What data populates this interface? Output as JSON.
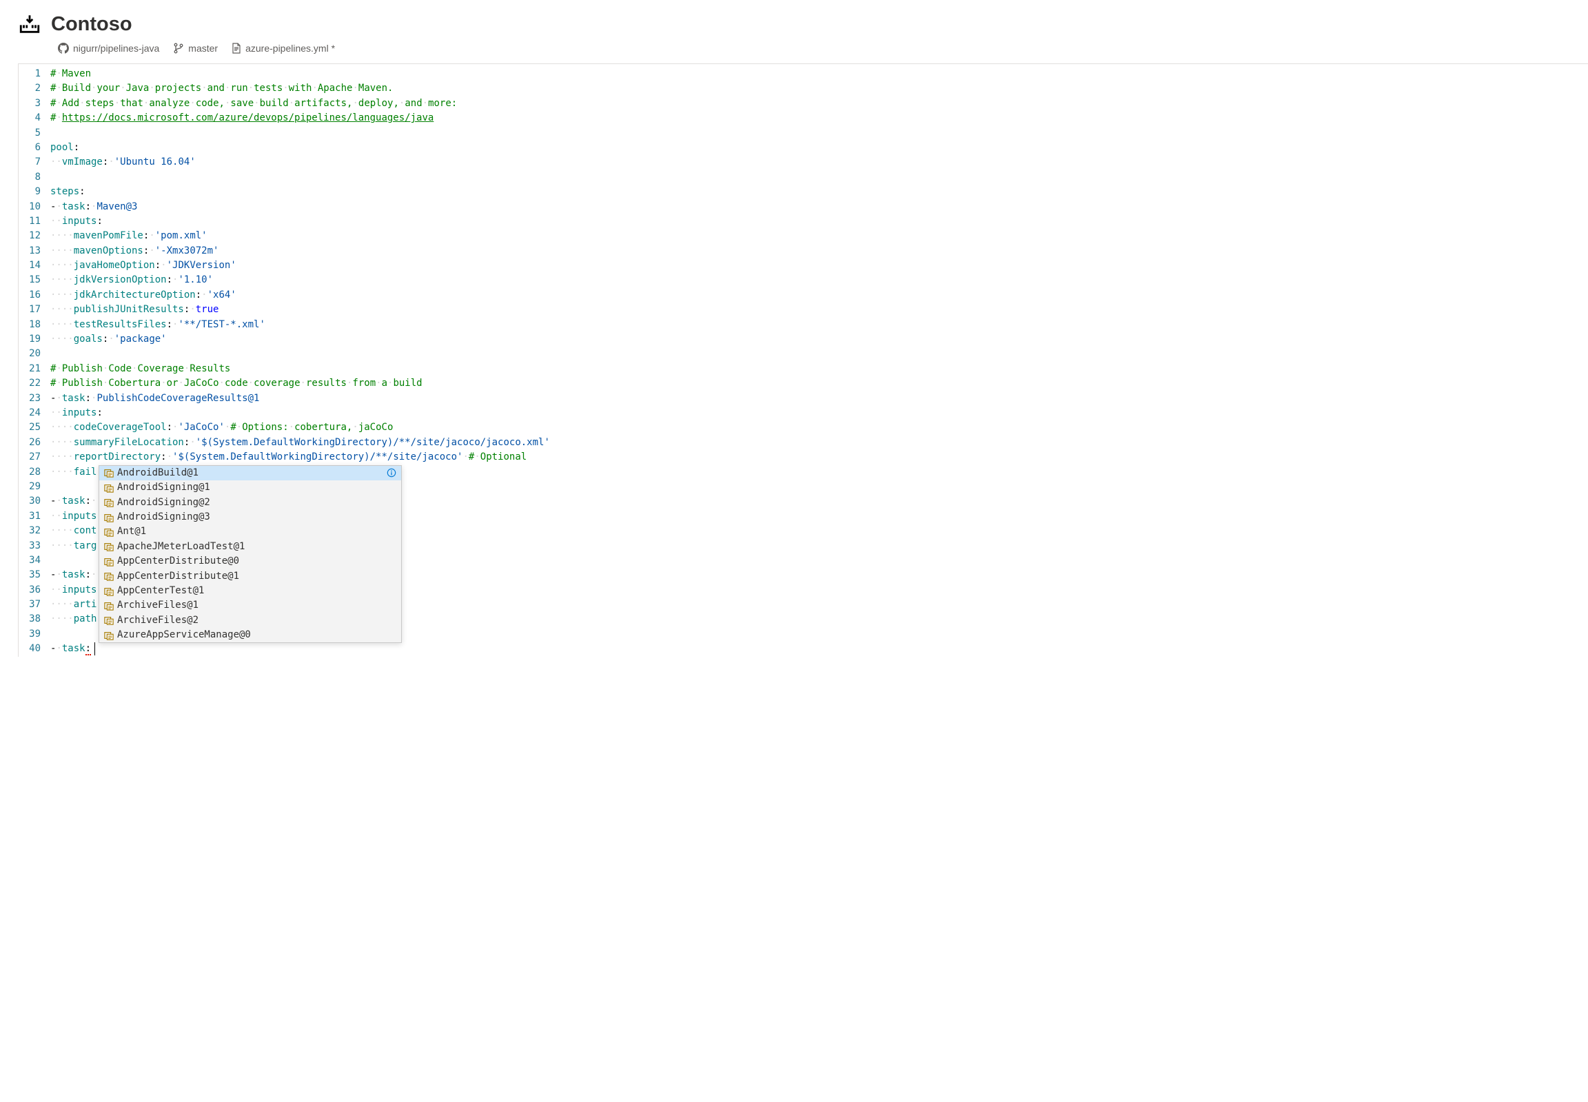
{
  "header": {
    "title": "Contoso"
  },
  "breadcrumb": {
    "repo": "nigurr/pipelines-java",
    "branch": "master",
    "file": "azure-pipelines.yml *"
  },
  "code": {
    "lines": [
      [
        {
          "t": "comment",
          "v": "#"
        },
        {
          "t": "ws",
          "v": "·"
        },
        {
          "t": "comment",
          "v": "Maven"
        }
      ],
      [
        {
          "t": "comment",
          "v": "#"
        },
        {
          "t": "ws",
          "v": "·"
        },
        {
          "t": "comment",
          "v": "Build"
        },
        {
          "t": "ws",
          "v": "·"
        },
        {
          "t": "comment",
          "v": "your"
        },
        {
          "t": "ws",
          "v": "·"
        },
        {
          "t": "comment",
          "v": "Java"
        },
        {
          "t": "ws",
          "v": "·"
        },
        {
          "t": "comment",
          "v": "projects"
        },
        {
          "t": "ws",
          "v": "·"
        },
        {
          "t": "comment",
          "v": "and"
        },
        {
          "t": "ws",
          "v": "·"
        },
        {
          "t": "comment",
          "v": "run"
        },
        {
          "t": "ws",
          "v": "·"
        },
        {
          "t": "comment",
          "v": "tests"
        },
        {
          "t": "ws",
          "v": "·"
        },
        {
          "t": "comment",
          "v": "with"
        },
        {
          "t": "ws",
          "v": "·"
        },
        {
          "t": "comment",
          "v": "Apache"
        },
        {
          "t": "ws",
          "v": "·"
        },
        {
          "t": "comment",
          "v": "Maven."
        }
      ],
      [
        {
          "t": "comment",
          "v": "#"
        },
        {
          "t": "ws",
          "v": "·"
        },
        {
          "t": "comment",
          "v": "Add"
        },
        {
          "t": "ws",
          "v": "·"
        },
        {
          "t": "comment",
          "v": "steps"
        },
        {
          "t": "ws",
          "v": "·"
        },
        {
          "t": "comment",
          "v": "that"
        },
        {
          "t": "ws",
          "v": "·"
        },
        {
          "t": "comment",
          "v": "analyze"
        },
        {
          "t": "ws",
          "v": "·"
        },
        {
          "t": "comment",
          "v": "code,"
        },
        {
          "t": "ws",
          "v": "·"
        },
        {
          "t": "comment",
          "v": "save"
        },
        {
          "t": "ws",
          "v": "·"
        },
        {
          "t": "comment",
          "v": "build"
        },
        {
          "t": "ws",
          "v": "·"
        },
        {
          "t": "comment",
          "v": "artifacts,"
        },
        {
          "t": "ws",
          "v": "·"
        },
        {
          "t": "comment",
          "v": "deploy,"
        },
        {
          "t": "ws",
          "v": "·"
        },
        {
          "t": "comment",
          "v": "and"
        },
        {
          "t": "ws",
          "v": "·"
        },
        {
          "t": "comment",
          "v": "more:"
        }
      ],
      [
        {
          "t": "comment",
          "v": "#"
        },
        {
          "t": "ws",
          "v": "·"
        },
        {
          "t": "comment-link",
          "v": "https://docs.microsoft.com/azure/devops/pipelines/languages/java"
        }
      ],
      [],
      [
        {
          "t": "key",
          "v": "pool"
        },
        {
          "t": "plain",
          "v": ":"
        }
      ],
      [
        {
          "t": "ws",
          "v": "··"
        },
        {
          "t": "key",
          "v": "vmImage"
        },
        {
          "t": "plain",
          "v": ":"
        },
        {
          "t": "ws",
          "v": "·"
        },
        {
          "t": "string",
          "v": "'Ubuntu 16.04'"
        }
      ],
      [],
      [
        {
          "t": "key",
          "v": "steps"
        },
        {
          "t": "plain",
          "v": ":"
        }
      ],
      [
        {
          "t": "plain",
          "v": "-"
        },
        {
          "t": "ws",
          "v": "·"
        },
        {
          "t": "key",
          "v": "task"
        },
        {
          "t": "plain",
          "v": ":"
        },
        {
          "t": "ws",
          "v": "·"
        },
        {
          "t": "string",
          "v": "Maven@3"
        }
      ],
      [
        {
          "t": "ws",
          "v": "··"
        },
        {
          "t": "key",
          "v": "inputs"
        },
        {
          "t": "plain",
          "v": ":"
        }
      ],
      [
        {
          "t": "ws",
          "v": "····"
        },
        {
          "t": "key",
          "v": "mavenPomFile"
        },
        {
          "t": "plain",
          "v": ":"
        },
        {
          "t": "ws",
          "v": "·"
        },
        {
          "t": "string",
          "v": "'pom.xml'"
        }
      ],
      [
        {
          "t": "ws",
          "v": "····"
        },
        {
          "t": "key",
          "v": "mavenOptions"
        },
        {
          "t": "plain",
          "v": ":"
        },
        {
          "t": "ws",
          "v": "·"
        },
        {
          "t": "string",
          "v": "'-Xmx3072m'"
        }
      ],
      [
        {
          "t": "ws",
          "v": "····"
        },
        {
          "t": "key",
          "v": "javaHomeOption"
        },
        {
          "t": "plain",
          "v": ":"
        },
        {
          "t": "ws",
          "v": "·"
        },
        {
          "t": "string",
          "v": "'JDKVersion'"
        }
      ],
      [
        {
          "t": "ws",
          "v": "····"
        },
        {
          "t": "key",
          "v": "jdkVersionOption"
        },
        {
          "t": "plain",
          "v": ":"
        },
        {
          "t": "ws",
          "v": "·"
        },
        {
          "t": "string",
          "v": "'1.10'"
        }
      ],
      [
        {
          "t": "ws",
          "v": "····"
        },
        {
          "t": "key",
          "v": "jdkArchitectureOption"
        },
        {
          "t": "plain",
          "v": ":"
        },
        {
          "t": "ws",
          "v": "·"
        },
        {
          "t": "string",
          "v": "'x64'"
        }
      ],
      [
        {
          "t": "ws",
          "v": "····"
        },
        {
          "t": "key",
          "v": "publishJUnitResults"
        },
        {
          "t": "plain",
          "v": ":"
        },
        {
          "t": "ws",
          "v": "·"
        },
        {
          "t": "bool",
          "v": "true"
        }
      ],
      [
        {
          "t": "ws",
          "v": "····"
        },
        {
          "t": "key",
          "v": "testResultsFiles"
        },
        {
          "t": "plain",
          "v": ":"
        },
        {
          "t": "ws",
          "v": "·"
        },
        {
          "t": "string",
          "v": "'**/TEST-*.xml'"
        }
      ],
      [
        {
          "t": "ws",
          "v": "····"
        },
        {
          "t": "key",
          "v": "goals"
        },
        {
          "t": "plain",
          "v": ":"
        },
        {
          "t": "ws",
          "v": "·"
        },
        {
          "t": "string",
          "v": "'package'"
        }
      ],
      [],
      [
        {
          "t": "comment",
          "v": "#"
        },
        {
          "t": "ws",
          "v": "·"
        },
        {
          "t": "comment",
          "v": "Publish"
        },
        {
          "t": "ws",
          "v": "·"
        },
        {
          "t": "comment",
          "v": "Code"
        },
        {
          "t": "ws",
          "v": "·"
        },
        {
          "t": "comment",
          "v": "Coverage"
        },
        {
          "t": "ws",
          "v": "·"
        },
        {
          "t": "comment",
          "v": "Results"
        }
      ],
      [
        {
          "t": "comment",
          "v": "#"
        },
        {
          "t": "ws",
          "v": "·"
        },
        {
          "t": "comment",
          "v": "Publish"
        },
        {
          "t": "ws",
          "v": "·"
        },
        {
          "t": "comment",
          "v": "Cobertura"
        },
        {
          "t": "ws",
          "v": "·"
        },
        {
          "t": "comment",
          "v": "or"
        },
        {
          "t": "ws",
          "v": "·"
        },
        {
          "t": "comment",
          "v": "JaCoCo"
        },
        {
          "t": "ws",
          "v": "·"
        },
        {
          "t": "comment",
          "v": "code"
        },
        {
          "t": "ws",
          "v": "·"
        },
        {
          "t": "comment",
          "v": "coverage"
        },
        {
          "t": "ws",
          "v": "·"
        },
        {
          "t": "comment",
          "v": "results"
        },
        {
          "t": "ws",
          "v": "·"
        },
        {
          "t": "comment",
          "v": "from"
        },
        {
          "t": "ws",
          "v": "·"
        },
        {
          "t": "comment",
          "v": "a"
        },
        {
          "t": "ws",
          "v": "·"
        },
        {
          "t": "comment",
          "v": "build"
        }
      ],
      [
        {
          "t": "plain",
          "v": "-"
        },
        {
          "t": "ws",
          "v": "·"
        },
        {
          "t": "key",
          "v": "task"
        },
        {
          "t": "plain",
          "v": ":"
        },
        {
          "t": "ws",
          "v": "·"
        },
        {
          "t": "string",
          "v": "PublishCodeCoverageResults@1"
        }
      ],
      [
        {
          "t": "ws",
          "v": "··"
        },
        {
          "t": "key",
          "v": "inputs"
        },
        {
          "t": "plain",
          "v": ":"
        }
      ],
      [
        {
          "t": "ws",
          "v": "····"
        },
        {
          "t": "key",
          "v": "codeCoverageTool"
        },
        {
          "t": "plain",
          "v": ":"
        },
        {
          "t": "ws",
          "v": "·"
        },
        {
          "t": "string",
          "v": "'JaCoCo'"
        },
        {
          "t": "ws",
          "v": "·"
        },
        {
          "t": "comment",
          "v": "#"
        },
        {
          "t": "ws",
          "v": "·"
        },
        {
          "t": "comment",
          "v": "Options:"
        },
        {
          "t": "ws",
          "v": "·"
        },
        {
          "t": "comment",
          "v": "cobertura,"
        },
        {
          "t": "ws",
          "v": "·"
        },
        {
          "t": "comment",
          "v": "jaCoCo"
        }
      ],
      [
        {
          "t": "ws",
          "v": "····"
        },
        {
          "t": "key",
          "v": "summaryFileLocation"
        },
        {
          "t": "plain",
          "v": ":"
        },
        {
          "t": "ws",
          "v": "·"
        },
        {
          "t": "string",
          "v": "'$(System.DefaultWorkingDirectory)/**/site/jacoco/jacoco.xml'"
        }
      ],
      [
        {
          "t": "ws",
          "v": "····"
        },
        {
          "t": "key",
          "v": "reportDirectory"
        },
        {
          "t": "plain",
          "v": ":"
        },
        {
          "t": "ws",
          "v": "·"
        },
        {
          "t": "string",
          "v": "'$(System.DefaultWorkingDirectory)/**/site/jacoco'"
        },
        {
          "t": "ws",
          "v": "·"
        },
        {
          "t": "comment",
          "v": "#"
        },
        {
          "t": "ws",
          "v": "·"
        },
        {
          "t": "comment",
          "v": "Optional"
        }
      ],
      [
        {
          "t": "ws",
          "v": "····"
        },
        {
          "t": "key",
          "v": "fail"
        }
      ],
      [],
      [
        {
          "t": "plain",
          "v": "-"
        },
        {
          "t": "ws",
          "v": "·"
        },
        {
          "t": "key",
          "v": "task"
        },
        {
          "t": "plain",
          "v": ":"
        },
        {
          "t": "ws",
          "v": "·"
        }
      ],
      [
        {
          "t": "ws",
          "v": "··"
        },
        {
          "t": "key",
          "v": "inputs"
        }
      ],
      [
        {
          "t": "ws",
          "v": "····"
        },
        {
          "t": "key",
          "v": "cont"
        }
      ],
      [
        {
          "t": "ws",
          "v": "····"
        },
        {
          "t": "key",
          "v": "targ"
        }
      ],
      [],
      [
        {
          "t": "plain",
          "v": "-"
        },
        {
          "t": "ws",
          "v": "·"
        },
        {
          "t": "key",
          "v": "task"
        },
        {
          "t": "plain",
          "v": ":"
        },
        {
          "t": "ws",
          "v": "·"
        }
      ],
      [
        {
          "t": "ws",
          "v": "··"
        },
        {
          "t": "key",
          "v": "inputs"
        }
      ],
      [
        {
          "t": "ws",
          "v": "····"
        },
        {
          "t": "key",
          "v": "arti"
        }
      ],
      [
        {
          "t": "ws",
          "v": "····"
        },
        {
          "t": "key",
          "v": "path"
        }
      ],
      [],
      [
        {
          "t": "plain",
          "v": "-"
        },
        {
          "t": "ws",
          "v": "·"
        },
        {
          "t": "key",
          "v": "task"
        },
        {
          "t": "plain-sq",
          "v": ":"
        }
      ]
    ],
    "line_count": 40
  },
  "autocomplete": {
    "selected_index": 0,
    "items": [
      "AndroidBuild@1",
      "AndroidSigning@1",
      "AndroidSigning@2",
      "AndroidSigning@3",
      "Ant@1",
      "ApacheJMeterLoadTest@1",
      "AppCenterDistribute@0",
      "AppCenterDistribute@1",
      "AppCenterTest@1",
      "ArchiveFiles@1",
      "ArchiveFiles@2",
      "AzureAppServiceManage@0"
    ]
  }
}
